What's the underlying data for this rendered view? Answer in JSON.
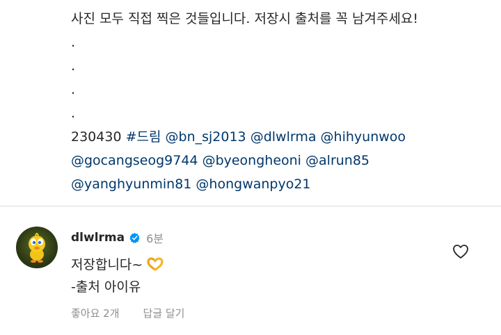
{
  "caption": {
    "line1": "사진 모두 직접 찍은 것들입니다. 저장시 출처를 꼭 남겨주세요!",
    "dot": ".",
    "date": "230430",
    "hashtag": "#드림",
    "mentions_line1": [
      "@bn_sj2013",
      "@dlwlrma",
      "@hihyunwoo"
    ],
    "mentions_line2": [
      "@gocangseog9744",
      "@byeongheoni",
      "@alrun85"
    ],
    "mentions_line3": [
      "@yanghyunmin81",
      "@hongwanpyo21"
    ]
  },
  "comment": {
    "username": "dlwlrma",
    "time": "6분",
    "text_line1": "저장합니다~",
    "text_line2": "-출처 아이유",
    "likes": "좋아요 2개",
    "reply": "답글 달기"
  },
  "colors": {
    "link": "#00376b",
    "verified": "#0095f6",
    "muted": "#8e8e8e"
  }
}
